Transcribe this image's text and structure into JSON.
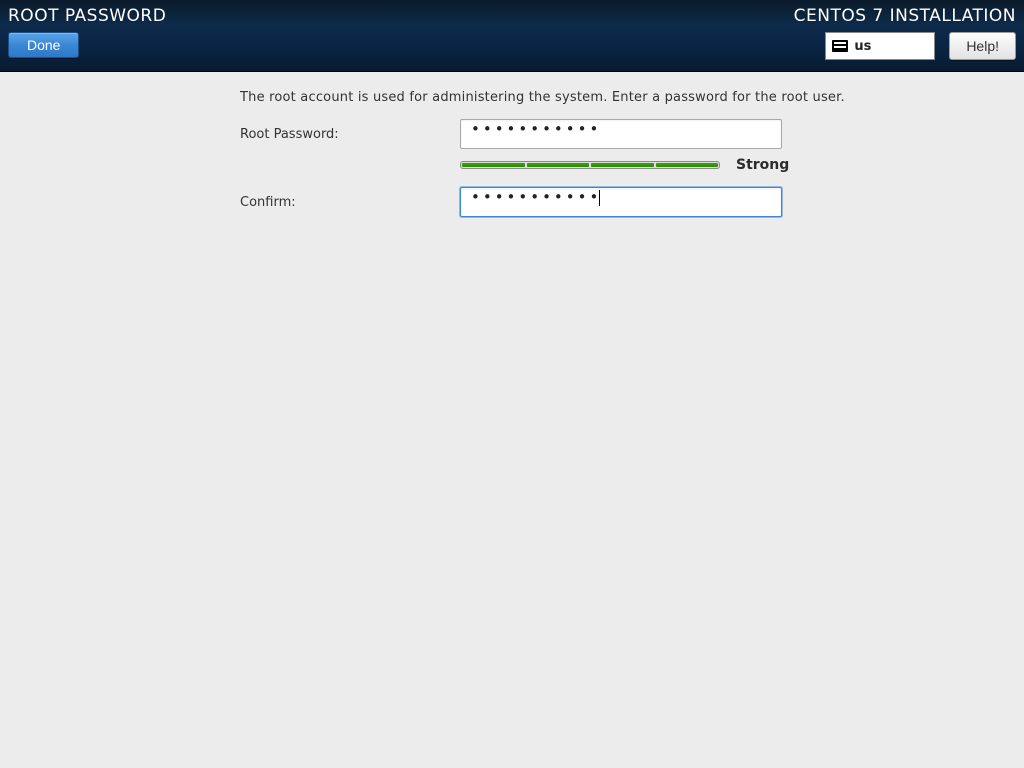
{
  "header": {
    "page_title": "ROOT PASSWORD",
    "done_label": "Done",
    "installer_title": "CENTOS 7 INSTALLATION",
    "keyboard_layout": "us",
    "help_label": "Help!"
  },
  "main": {
    "instruction": "The root account is used for administering the system.  Enter a password for the root user.",
    "root_password_label": "Root Password:",
    "root_password_value": "•••••••••••",
    "confirm_label": "Confirm:",
    "confirm_value": "•••••••••••",
    "strength_label": "Strong",
    "strength_segments_filled": 4
  },
  "colors": {
    "accent_blue": "#3b87d6",
    "strength_green": "#2f9a08"
  }
}
